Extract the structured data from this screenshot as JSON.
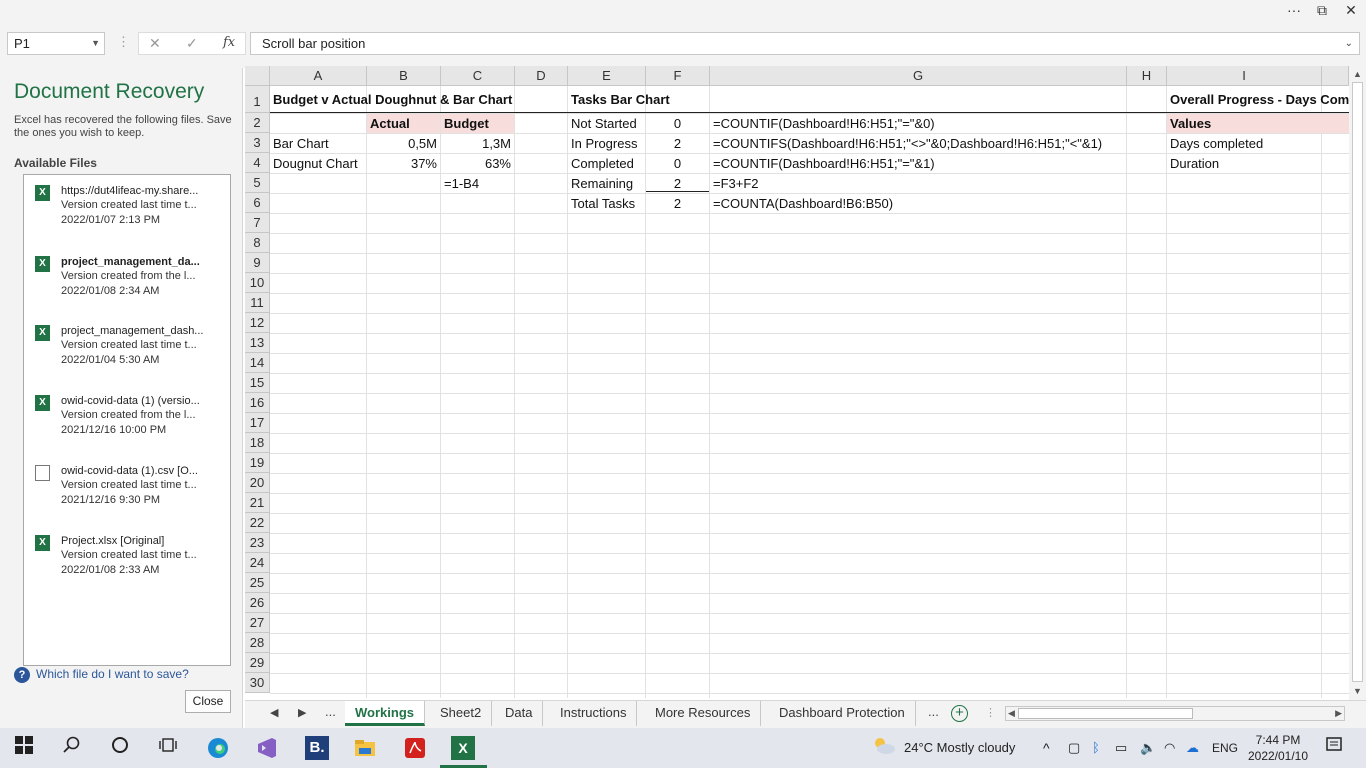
{
  "window": {
    "more_glyph": "···",
    "restore_glyph": "⧉",
    "close_glyph": "✕"
  },
  "formula_bar": {
    "name_box": "P1",
    "cancel_glyph": "✕",
    "enter_glyph": "✓",
    "fx_label": "fx",
    "value": "Scroll bar position"
  },
  "recovery": {
    "title": "Document Recovery",
    "description": "Excel has recovered the following files. Save the ones you wish to keep.",
    "available_label": "Available Files",
    "files": [
      {
        "name": "https://dut4lifeac-my.share...",
        "line2": "Version created last time t...",
        "date": "2022/01/07 2:13 PM",
        "icon": "excel-icon",
        "bold": false
      },
      {
        "name": "project_management_da...",
        "line2": "Version created from the l...",
        "date": "2022/01/08 2:34 AM",
        "icon": "excel-icon",
        "bold": true
      },
      {
        "name": "project_management_dash...",
        "line2": "Version created last time t...",
        "date": "2022/01/04 5:30 AM",
        "icon": "excel-icon",
        "bold": false
      },
      {
        "name": "owid-covid-data (1) (versio...",
        "line2": "Version created from the l...",
        "date": "2021/12/16 10:00 PM",
        "icon": "excel-icon",
        "bold": false
      },
      {
        "name": "owid-covid-data (1).csv  [O...",
        "line2": "Version created last time t...",
        "date": "2021/12/16 9:30 PM",
        "icon": "document-icon",
        "bold": false
      },
      {
        "name": "Project.xlsx  [Original]",
        "line2": "Version created last time t...",
        "date": "2022/01/08 2:33 AM",
        "icon": "excel-icon",
        "bold": false
      }
    ],
    "help_text": "Which file do I want to save?",
    "close_label": "Close"
  },
  "sheet": {
    "columns": [
      "A",
      "B",
      "C",
      "D",
      "E",
      "F",
      "G",
      "H",
      "I"
    ],
    "rows": [
      "1",
      "2",
      "3",
      "4",
      "5",
      "6",
      "7",
      "8",
      "9",
      "10",
      "11",
      "12",
      "13",
      "14",
      "15",
      "16",
      "17",
      "18",
      "19",
      "20",
      "21",
      "22",
      "23",
      "24",
      "25",
      "26",
      "27",
      "28",
      "29",
      "30"
    ],
    "cells": {
      "A1": "Budget v Actual Doughnut & Bar Chart",
      "B2": "Actual",
      "C2": "Budget",
      "A3": "Bar Chart",
      "B3": "0,5M",
      "C3": "1,3M",
      "A4": "Dougnut Chart",
      "B4": "37%",
      "C4": "63%",
      "C5": "=1-B4",
      "E1": "Tasks Bar Chart",
      "E2": "Not Started",
      "F2": "0",
      "G2": "=COUNTIF(Dashboard!H6:H51;\"=\"&0)",
      "E3": "In Progress",
      "F3": "2",
      "G3": "=COUNTIFS(Dashboard!H6:H51;\"<>\"&0;Dashboard!H6:H51;\"<\"&1)",
      "E4": "Completed",
      "F4": "0",
      "G4": "=COUNTIF(Dashboard!H6:H51;\"=\"&1)",
      "E5": "Remaining",
      "F5": "2",
      "G5": "=F3+F2",
      "E6": "Total Tasks",
      "F6": "2",
      "G6": "=COUNTA(Dashboard!B6:B50)",
      "I1": "Overall Progress - Days Comp",
      "I2": "Values",
      "I3": "Days completed",
      "I4": "Duration"
    }
  },
  "sheet_tabs": {
    "prev_glyph": "◀",
    "next_glyph": "▶",
    "ellipsis": "...",
    "tabs": [
      "Workings",
      "Sheet2",
      "Data",
      "Instructions",
      "More Resources",
      "Dashboard Protection"
    ],
    "active": "Workings",
    "add_glyph": "+"
  },
  "taskbar": {
    "weather": "24°C  Mostly cloudy",
    "language": "ENG",
    "time": "7:44 PM",
    "date": "2022/01/10"
  },
  "colors": {
    "excel_green": "#217346",
    "header_pink": "#f8dddd",
    "link_blue": "#2b579a"
  }
}
